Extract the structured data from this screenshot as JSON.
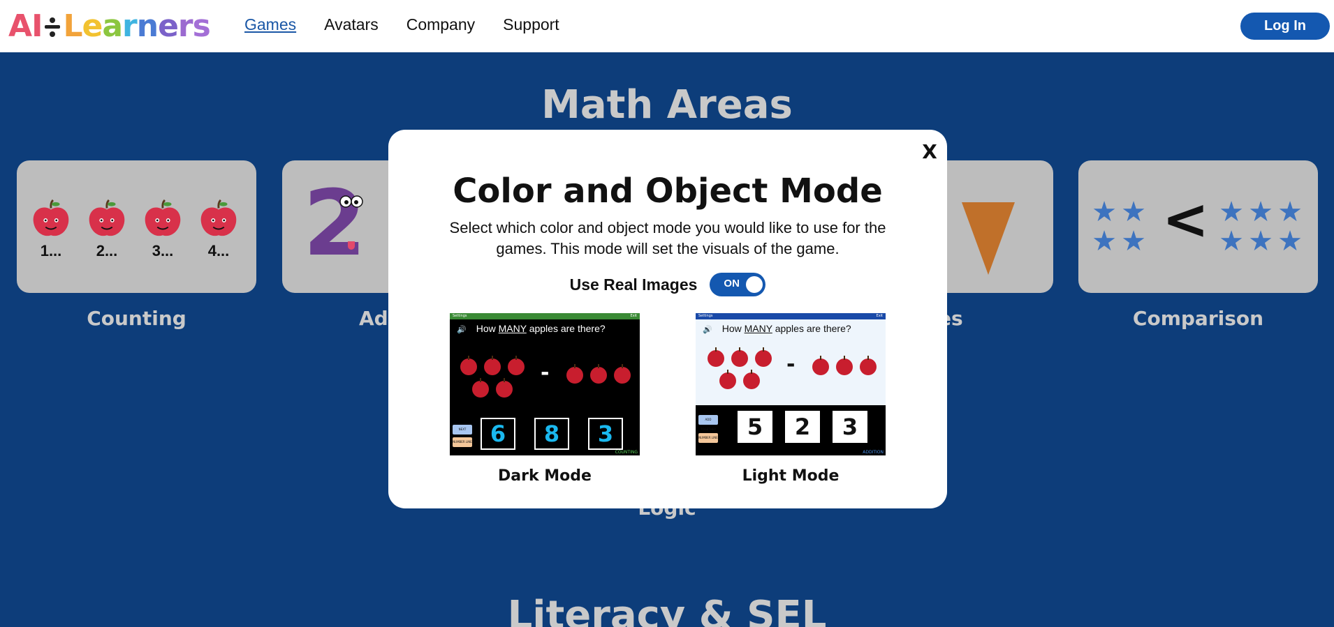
{
  "header": {
    "logo_letters": [
      {
        "ch": "A",
        "color": "#e8526c"
      },
      {
        "ch": "I",
        "color": "#e8526c"
      },
      {
        "ch": "L",
        "color": "#f2a33a"
      },
      {
        "ch": "e",
        "color": "#f2c230"
      },
      {
        "ch": "a",
        "color": "#8cc63f"
      },
      {
        "ch": "r",
        "color": "#3fb4e0"
      },
      {
        "ch": "n",
        "color": "#4b7bd4"
      },
      {
        "ch": "e",
        "color": "#7b62c9"
      },
      {
        "ch": "r",
        "color": "#9b6ad0"
      },
      {
        "ch": "s",
        "color": "#a36fd6"
      }
    ],
    "nav": [
      {
        "label": "Games",
        "active": true
      },
      {
        "label": "Avatars",
        "active": false
      },
      {
        "label": "Company",
        "active": false
      },
      {
        "label": "Support",
        "active": false
      }
    ],
    "login_label": "Log In"
  },
  "background": {
    "math_title": "Math Areas",
    "literacy_title": "Literacy & SEL",
    "cards": [
      {
        "label": "Counting",
        "numbers": [
          "1...",
          "2...",
          "3...",
          "4..."
        ]
      },
      {
        "label": "Ad",
        "figure": "2"
      },
      {
        "label": "es"
      },
      {
        "label": "Comparison",
        "symbol": "<"
      }
    ],
    "logic_label": "Logic"
  },
  "modal": {
    "close_label": "X",
    "title": "Color and Object Mode",
    "description": "Select which color and object mode you would like to use for the games. This mode will set the visuals of the game.",
    "toggle_label": "Use Real Images",
    "toggle_state": "ON",
    "options": [
      {
        "label": "Dark Mode",
        "question_prefix": "How ",
        "question_emph": "MANY",
        "question_suffix": " apples are there?",
        "numbers": [
          "6",
          "8",
          "3"
        ],
        "corner_tag": "COUNTING",
        "top_left": "Settings",
        "top_right": "Exit",
        "side_buttons": [
          "NEXT",
          "NUMBER LINE"
        ]
      },
      {
        "label": "Light Mode",
        "question_prefix": "How ",
        "question_emph": "MANY",
        "question_suffix": " apples are there?",
        "numbers": [
          "5",
          "2",
          "3"
        ],
        "corner_tag": "ADDITION",
        "top_left": "Settings",
        "top_right": "Exit",
        "side_buttons": [
          "ADD TOGETHER",
          "NUMBER LINE"
        ]
      }
    ]
  }
}
